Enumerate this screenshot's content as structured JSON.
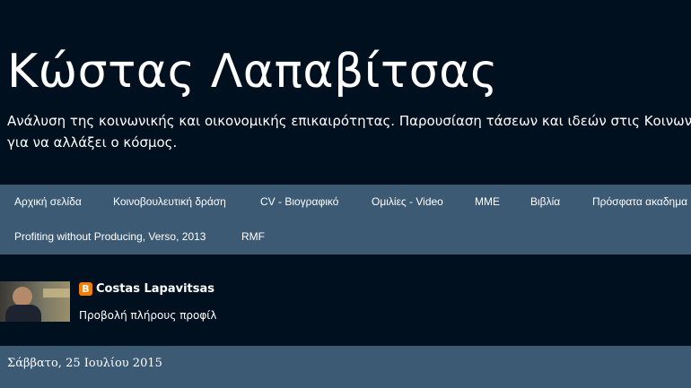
{
  "header": {
    "title": "Κώστας Λαπαβίτσας",
    "description_line1": "Ανάλυση της κοινωνικής και οικονομικής επικαιρότητας. Παρουσίαση τάσεων και ιδεών στις Κοινωνι",
    "description_line2": "για να αλλάξει ο κόσμος."
  },
  "nav": {
    "row1": [
      "Αρχική σελίδα",
      "Κοινοβουλευτική δράση",
      "CV - Βιογραφικό",
      "Ομιλίες - Video",
      "MME",
      "Βιβλία",
      "Πρόσφατα ακαδημα"
    ],
    "row2": [
      "Profiting without Producing, Verso, 2013",
      "RMF"
    ]
  },
  "profile": {
    "icon": "blogger-icon",
    "icon_glyph": "B",
    "name": "Costas Lapavitsas",
    "link": "Προβολή πλήρους προφίλ"
  },
  "date_header": "Σάββατο, 25 Ιουλίου 2015",
  "colors": {
    "background": "#01101f",
    "bar": "#3c5a73",
    "blogger": "#f57d00"
  }
}
